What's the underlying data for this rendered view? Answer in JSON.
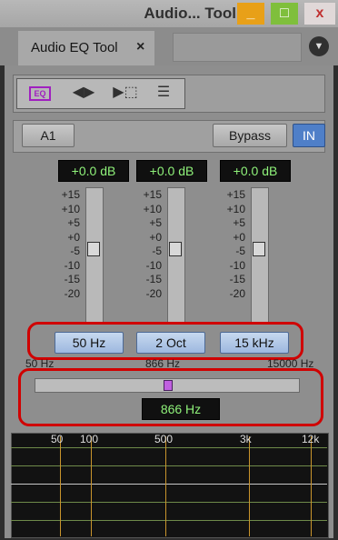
{
  "window": {
    "title": "Audio... Tool",
    "min_glyph": "_",
    "max_glyph": "□",
    "close_glyph": "x"
  },
  "tab": {
    "label": "Audio EQ Tool",
    "close_glyph": "×",
    "menu_glyph": "▼"
  },
  "toolbar": {
    "eq_label": "EQ",
    "swap_glyph": "◀▶",
    "frame_glyph": "▶⬚",
    "split_glyph": "☰"
  },
  "channel": {
    "name": "A1",
    "bypass_label": "Bypass",
    "in_label": "IN"
  },
  "bands": [
    {
      "gain": "+0.0 dB",
      "param": "50 Hz",
      "gain_db": 0
    },
    {
      "gain": "+0.0 dB",
      "param": "2 Oct",
      "gain_db": 0
    },
    {
      "gain": "+0.0 dB",
      "param": "15 kHz",
      "gain_db": 0
    }
  ],
  "scale": [
    "+15",
    "+10",
    "+5",
    "+0",
    "-5",
    "-10",
    "-15",
    "-20"
  ],
  "freq_slider": {
    "min_label": "50 Hz",
    "mid_label": "866 Hz",
    "max_label": "15000 Hz",
    "value": "866 Hz"
  },
  "graph": {
    "labels": [
      "50",
      "100",
      "500",
      "3k",
      "12k"
    ]
  },
  "colors": {
    "accent_in": "#4f7fc8",
    "readout_text": "#8ff27a",
    "highlight": "#d00000",
    "grid": "#6f8a4a",
    "marker": "#c9942c"
  }
}
